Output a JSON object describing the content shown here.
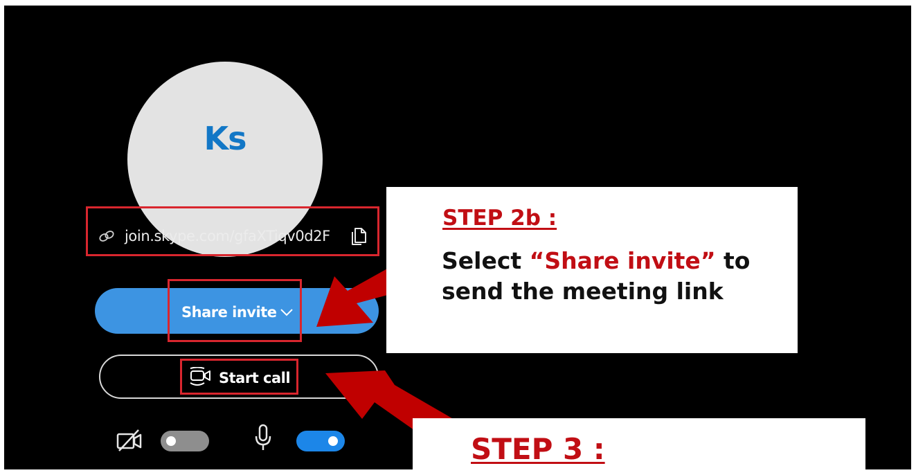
{
  "avatar": {
    "initials": "Ks"
  },
  "meeting_link": {
    "text": "join.skype.com/gfaXTiqv0d2F",
    "link_icon": "link-icon",
    "copy_icon": "copy-icon"
  },
  "share_button": {
    "label": "Share invite",
    "icon": "chevron-down-icon"
  },
  "start_call_button": {
    "label": "Start call",
    "icon": "video-call-icon"
  },
  "media_controls": {
    "camera": {
      "icon": "camera-off-icon",
      "enabled": false
    },
    "microphone": {
      "icon": "microphone-icon",
      "enabled": true
    }
  },
  "callouts": {
    "step2b": {
      "title": "STEP 2b :",
      "text_before": "Select ",
      "highlight": "“Share invite”",
      "text_after": " to send the meeting link"
    },
    "step3": {
      "title": "STEP 3 :"
    }
  },
  "colors": {
    "background": "#000000",
    "accent_blue": "#3d94e2",
    "highlight_red": "#d9262e",
    "arrow_red": "#c00000",
    "avatar_bg": "#e3e3e3",
    "avatar_text": "#1277c6"
  }
}
